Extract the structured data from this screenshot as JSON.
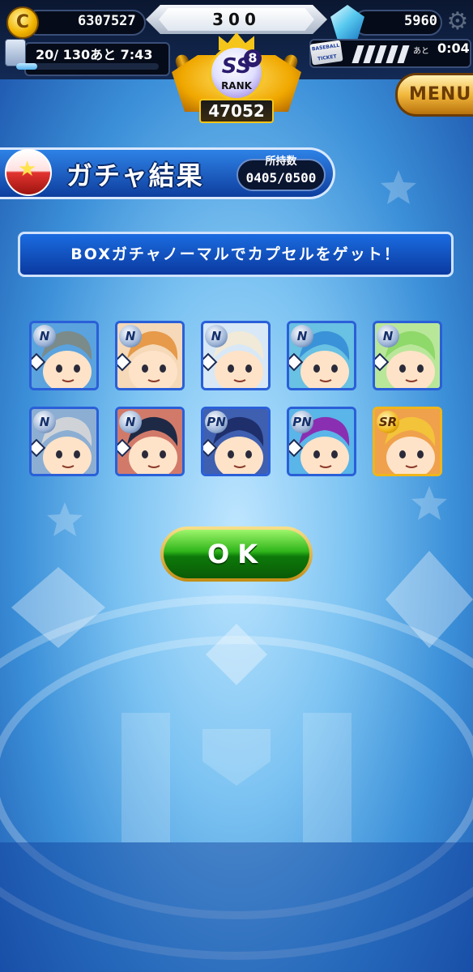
{
  "header": {
    "coins": "6307527",
    "center_value": "300",
    "gems": "5960",
    "stamina": "20/ 130あと 7:43",
    "stamina_fill": 0.15,
    "ticket_label": "あと",
    "ticket_time": "0:04",
    "ticket_icon_text": "BASEBALL TICKET",
    "rank": {
      "tier": "SS",
      "level": "8",
      "label": "RANK",
      "score": "47052"
    },
    "menu_label": "MENU"
  },
  "title": {
    "text": "ガチャ結果",
    "owned_label": "所持数",
    "owned_value": "0405/0500"
  },
  "message": "BOXガチャノーマルでカプセルをゲット！",
  "cards": [
    {
      "rarity": "N",
      "hair": "#7a8b8a",
      "bg": "#5aa3df"
    },
    {
      "rarity": "N",
      "hair": "#e69a4a",
      "bg": "#f5d9b8"
    },
    {
      "rarity": "N",
      "hair": "#f1ead8",
      "bg": "#d8e8f6"
    },
    {
      "rarity": "N",
      "hair": "#3a93d8",
      "bg": "#69c1e3"
    },
    {
      "rarity": "N",
      "hair": "#8fd86a",
      "bg": "#b9e79a"
    },
    {
      "rarity": "N",
      "hair": "#cfd3d8",
      "bg": "#8caed3"
    },
    {
      "rarity": "N",
      "hair": "#1e2a45",
      "bg": "#d27a6a"
    },
    {
      "rarity": "PN",
      "hair": "#1e2f6b",
      "bg": "#3f5fb0"
    },
    {
      "rarity": "PN",
      "hair": "#8a2fb2",
      "bg": "#5ab5e8"
    },
    {
      "rarity": "SR",
      "hair": "#f3c33a",
      "bg": "#f0a14b"
    }
  ],
  "ok_label": "OK",
  "colors": {
    "accent_blue": "#0b3aa0",
    "ok_green": "#2fb51a",
    "gold": "#f6c51a"
  }
}
